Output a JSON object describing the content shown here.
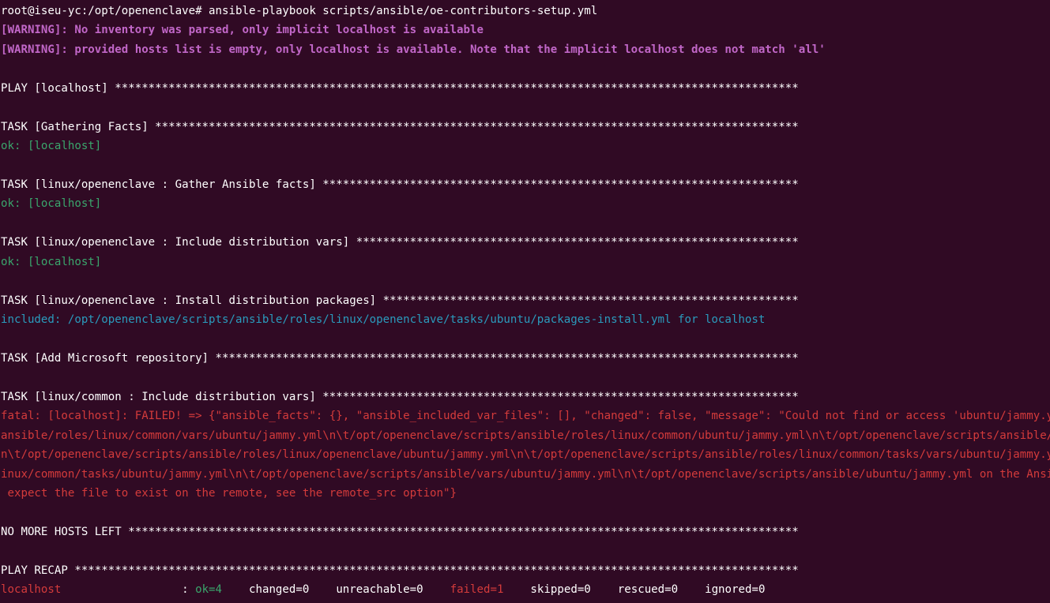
{
  "terminal": {
    "colors": {
      "background": "#300a24",
      "text": "#ffffff",
      "warning": "#c167c8",
      "ok": "#3aa66c",
      "included": "#2a9bbd",
      "fatal": "#d43b3b"
    },
    "prompt": "root@iseu-yc:/opt/openenclave# ",
    "command": "ansible-playbook scripts/ansible/oe-contributors-setup.yml",
    "warnings": [
      "[WARNING]: No inventory was parsed, only implicit localhost is available",
      "[WARNING]: provided hosts list is empty, only localhost is available. Note that the implicit localhost does not match 'all'"
    ],
    "play_header": "PLAY [localhost] ******************************************************************************************************",
    "tasks": [
      {
        "header": "TASK [Gathering Facts] ************************************************************************************************",
        "result": "ok: [localhost]"
      },
      {
        "header": "TASK [linux/openenclave : Gather Ansible facts] ***********************************************************************",
        "result": "ok: [localhost]"
      },
      {
        "header": "TASK [linux/openenclave : Include distribution vars] ******************************************************************",
        "result": "ok: [localhost]"
      },
      {
        "header": "TASK [linux/openenclave : Install distribution packages] **************************************************************",
        "result": "included: /opt/openenclave/scripts/ansible/roles/linux/openenclave/tasks/ubuntu/packages-install.yml for localhost"
      },
      {
        "header": "TASK [Add Microsoft repository] ***************************************************************************************"
      },
      {
        "header": "TASK [linux/common : Include distribution vars] ***********************************************************************",
        "error_lines": [
          "fatal: [localhost]: FAILED! => {\"ansible_facts\": {}, \"ansible_included_var_files\": [], \"changed\": false, \"message\": \"Could not find or access 'ubuntu/jammy.y",
          "ansible/roles/linux/common/vars/ubuntu/jammy.yml\\n\\t/opt/openenclave/scripts/ansible/roles/linux/common/ubuntu/jammy.yml\\n\\t/opt/openenclave/scripts/ansible/",
          "n\\t/opt/openenclave/scripts/ansible/roles/linux/openenclave/ubuntu/jammy.yml\\n\\t/opt/openenclave/scripts/ansible/roles/linux/common/tasks/vars/ubuntu/jammy.y",
          "inux/common/tasks/ubuntu/jammy.yml\\n\\t/opt/openenclave/scripts/ansible/vars/ubuntu/jammy.yml\\n\\t/opt/openenclave/scripts/ansible/ubuntu/jammy.yml on the Ansi",
          " expect the file to exist on the remote, see the remote_src option\"}"
        ]
      }
    ],
    "no_more_hosts": "NO MORE HOSTS LEFT ****************************************************************************************************",
    "recap_header": "PLAY RECAP ************************************************************************************************************",
    "recap": {
      "host": "localhost",
      "host_pad": "                  : ",
      "ok": "ok=4",
      "sep1": "    ",
      "changed": "changed=0",
      "sep2": "    ",
      "unreachable": "unreachable=0",
      "sep3": "    ",
      "failed": "failed=1",
      "sep4": "    ",
      "skipped": "skipped=0",
      "sep5": "    ",
      "rescued": "rescued=0",
      "sep6": "    ",
      "ignored": "ignored=0"
    }
  }
}
